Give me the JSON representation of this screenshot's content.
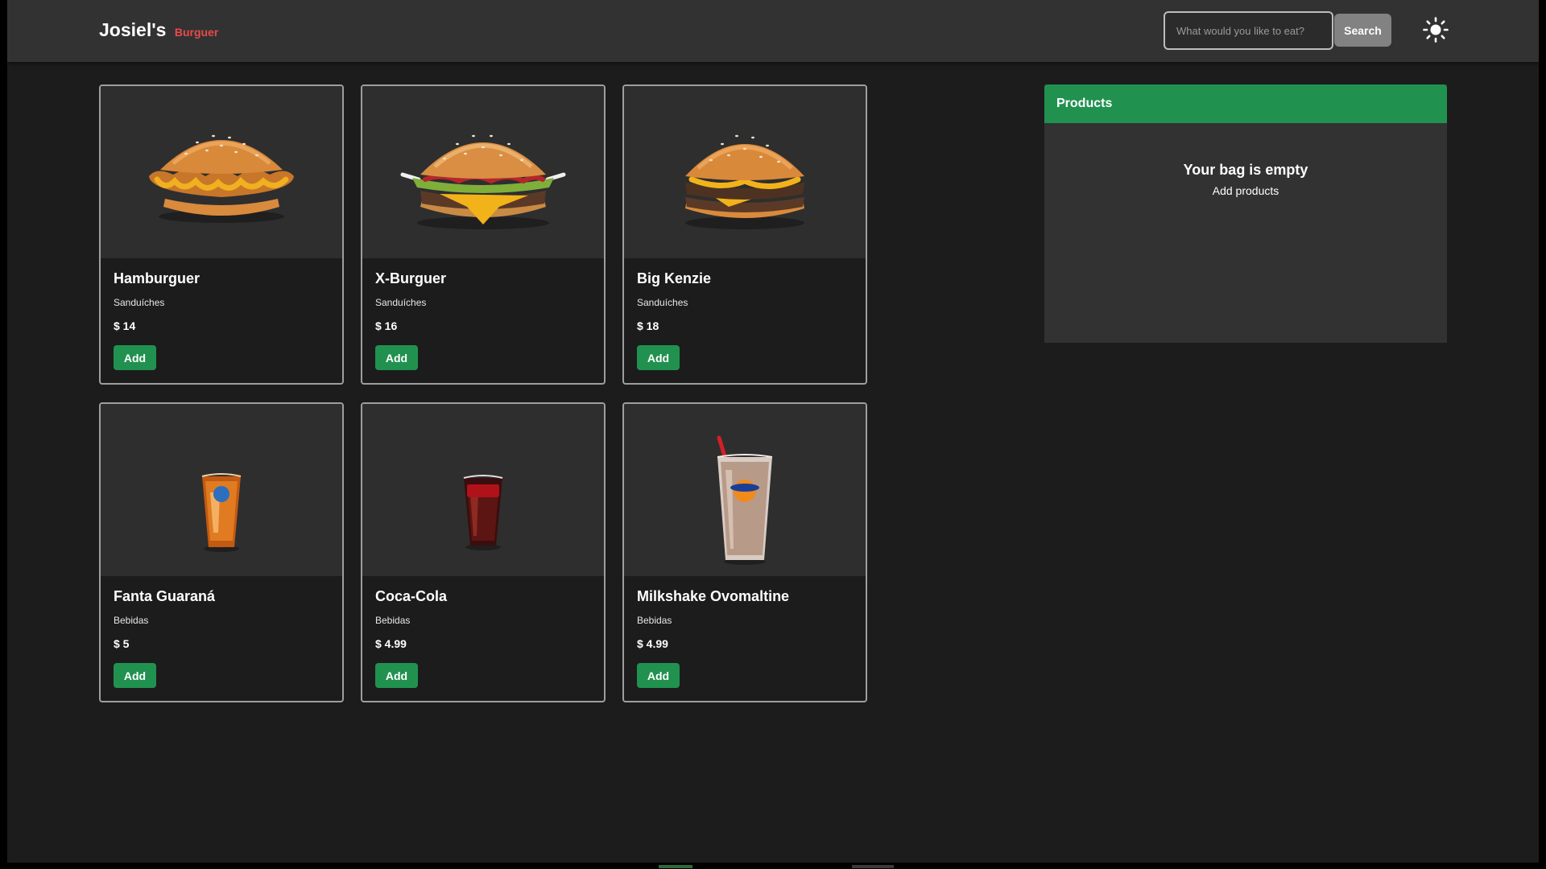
{
  "header": {
    "brand_main": "Josiel's",
    "brand_sub": "Burguer",
    "search_placeholder": "What would you like to eat?",
    "search_label": "Search",
    "theme_icon": "sun-icon"
  },
  "products": [
    {
      "name": "Hamburguer",
      "category": "Sanduíches",
      "price": "$ 14",
      "add_label": "Add",
      "image": "burger"
    },
    {
      "name": "X-Burguer",
      "category": "Sanduíches",
      "price": "$ 16",
      "add_label": "Add",
      "image": "cheeseburger"
    },
    {
      "name": "Big Kenzie",
      "category": "Sanduíches",
      "price": "$ 18",
      "add_label": "Add",
      "image": "double-burger"
    },
    {
      "name": "Fanta Guaraná",
      "category": "Bebidas",
      "price": "$ 5",
      "add_label": "Add",
      "image": "fanta-cup"
    },
    {
      "name": "Coca-Cola",
      "category": "Bebidas",
      "price": "$ 4.99",
      "add_label": "Add",
      "image": "coke-cup"
    },
    {
      "name": "Milkshake Ovomaltine",
      "category": "Bebidas",
      "price": "$ 4.99",
      "add_label": "Add",
      "image": "milkshake-cup"
    }
  ],
  "cart": {
    "title": "Products",
    "empty_title": "Your bag is empty",
    "empty_subtitle": "Add products"
  },
  "colors": {
    "accent": "#219150",
    "brand_sub": "#e84a4a",
    "background": "#1c1c1c",
    "surface": "#323232"
  }
}
